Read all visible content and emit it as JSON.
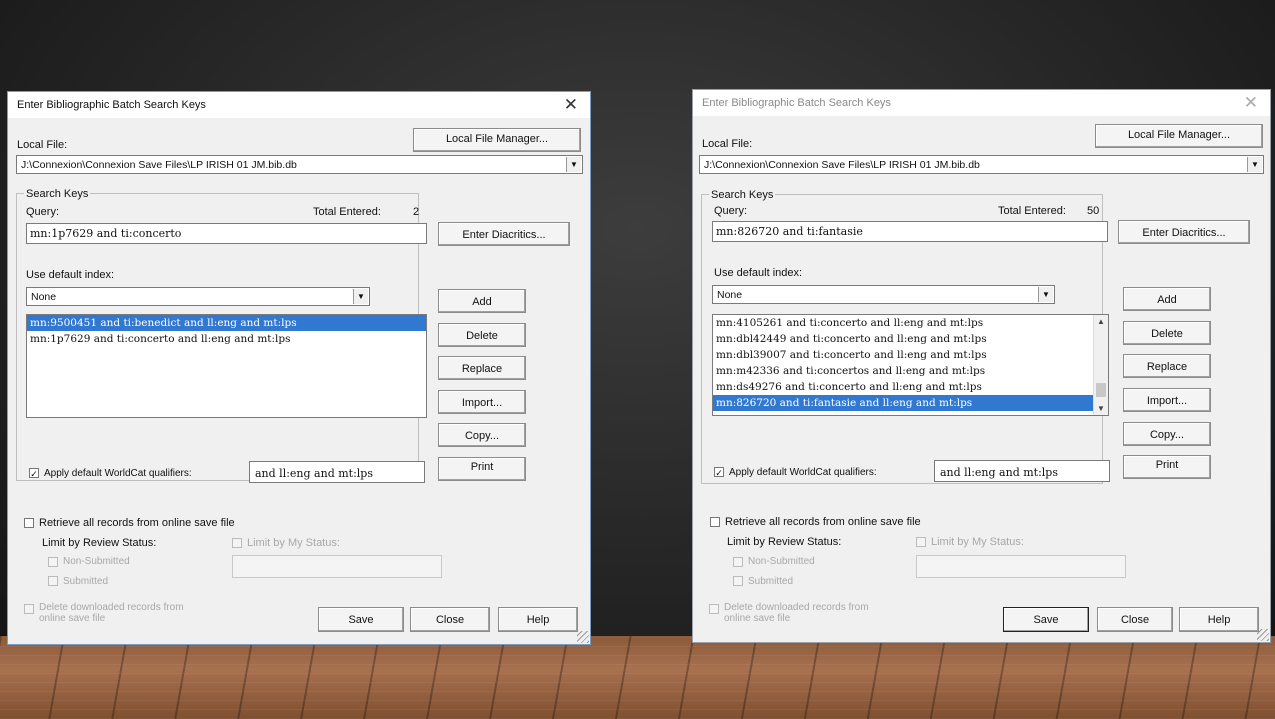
{
  "dialogs": [
    {
      "title": "Enter Bibliographic Batch Search Keys",
      "close_glyph": "✕",
      "local_file_label": "Local File:",
      "local_file_manager_label": "Local File Manager...",
      "local_file_path": "J:\\Connexion\\Connexion Save Files\\LP IRISH 01 JM.bib.db",
      "search_keys_label": "Search Keys",
      "query_label": "Query:",
      "total_entered_label": "Total Entered:",
      "total_entered_value": "2",
      "query_value": "mn:1p7629 and ti:concerto",
      "enter_diacritics_label": "Enter Diacritics...",
      "use_default_index_label": "Use default index:",
      "default_index_value": "None",
      "list_items": [
        {
          "text": "mn:9500451 and ti:benedict and ll:eng and mt:lps",
          "selected": true
        },
        {
          "text": "mn:1p7629 and ti:concerto and ll:eng and mt:lps",
          "selected": false
        }
      ],
      "buttons": {
        "add": "Add",
        "delete": "Delete",
        "replace": "Replace",
        "import": "Import...",
        "copy": "Copy...",
        "print": "Print"
      },
      "apply_qualifiers_label": "Apply default WorldCat qualifiers:",
      "apply_qualifiers_check": "✓",
      "qualifiers_value": "and ll:eng and mt:lps",
      "retrieve_label": "Retrieve all records from online save file",
      "limit_review_label": "Limit by Review Status:",
      "limit_my_status_label": "Limit by My Status:",
      "non_submitted_label": "Non-Submitted",
      "submitted_label": "Submitted",
      "delete_downloaded_label_1": "Delete downloaded records from",
      "delete_downloaded_label_2": "online save file",
      "save_label": "Save",
      "close_label": "Close",
      "help_label": "Help"
    },
    {
      "title": "Enter Bibliographic Batch Search Keys",
      "close_glyph": "✕",
      "local_file_label": "Local File:",
      "local_file_manager_label": "Local File Manager...",
      "local_file_path": "J:\\Connexion\\Connexion Save Files\\LP IRISH 01 JM.bib.db",
      "search_keys_label": "Search Keys",
      "query_label": "Query:",
      "total_entered_label": "Total Entered:",
      "total_entered_value": "50",
      "query_value": "mn:826720 and ti:fantasie",
      "enter_diacritics_label": "Enter Diacritics...",
      "use_default_index_label": "Use default index:",
      "default_index_value": "None",
      "list_items": [
        {
          "text": "mn:4105261 and ti:concerto and ll:eng and mt:lps",
          "selected": false
        },
        {
          "text": "mn:dbl42449 and ti:concerto and ll:eng and mt:lps",
          "selected": false
        },
        {
          "text": "mn:dbl39007 and ti:concerto and ll:eng and mt:lps",
          "selected": false
        },
        {
          "text": "mn:m42336 and ti:concertos and ll:eng and mt:lps",
          "selected": false
        },
        {
          "text": "mn:ds49276 and ti:concerto and ll:eng and mt:lps",
          "selected": false
        },
        {
          "text": "mn:826720 and ti:fantasie and ll:eng and mt:lps",
          "selected": true
        }
      ],
      "buttons": {
        "add": "Add",
        "delete": "Delete",
        "replace": "Replace",
        "import": "Import...",
        "copy": "Copy...",
        "print": "Print"
      },
      "apply_qualifiers_label": "Apply default WorldCat qualifiers:",
      "apply_qualifiers_check": "✓",
      "qualifiers_value": "and ll:eng and mt:lps",
      "retrieve_label": "Retrieve all records from online save file",
      "limit_review_label": "Limit by Review Status:",
      "limit_my_status_label": "Limit by My Status:",
      "non_submitted_label": "Non-Submitted",
      "submitted_label": "Submitted",
      "delete_downloaded_label_1": "Delete downloaded records from",
      "delete_downloaded_label_2": "online save file",
      "save_label": "Save",
      "close_label": "Close",
      "help_label": "Help"
    }
  ]
}
